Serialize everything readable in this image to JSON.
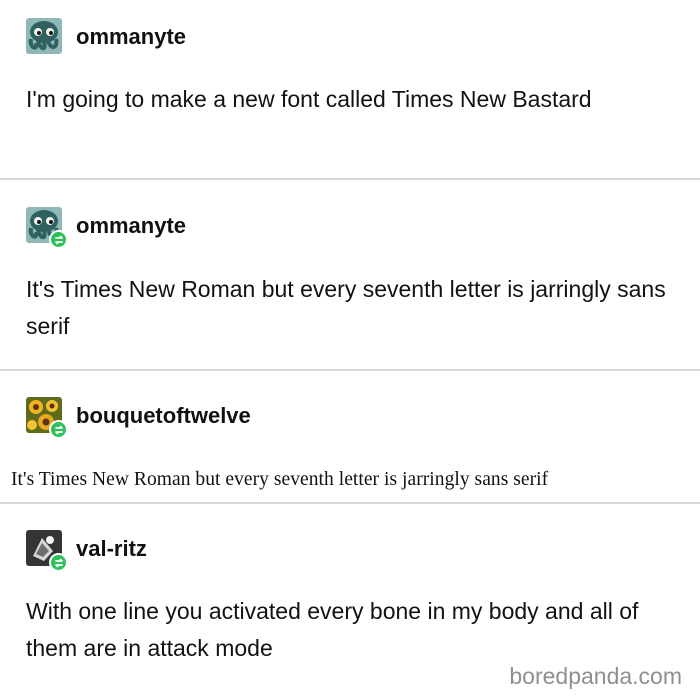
{
  "posts": [
    {
      "username": "ommanyte",
      "avatar_icon": "octopus-avatar",
      "reblogged": false,
      "text": "I'm going to make a new font called Times New Bastard"
    },
    {
      "username": "ommanyte",
      "avatar_icon": "octopus-avatar",
      "reblogged": true,
      "text": "It's Times New Roman but every seventh letter is jarringly sans serif"
    },
    {
      "username": "bouquetoftwelve",
      "avatar_icon": "sunflower-avatar",
      "reblogged": true,
      "text": "It's Times New Roman but every seventh letter is jarringly sans serif"
    },
    {
      "username": "val-ritz",
      "avatar_icon": "sketch-avatar",
      "reblogged": true,
      "text": "With one line you activated every bone in my body and all of them are in attack mode"
    }
  ],
  "watermark": "boredpanda.com",
  "colors": {
    "reblog_badge": "#2ec15b",
    "divider": "#d8d8d8",
    "text": "#111111",
    "watermark": "#8f8f8f"
  }
}
